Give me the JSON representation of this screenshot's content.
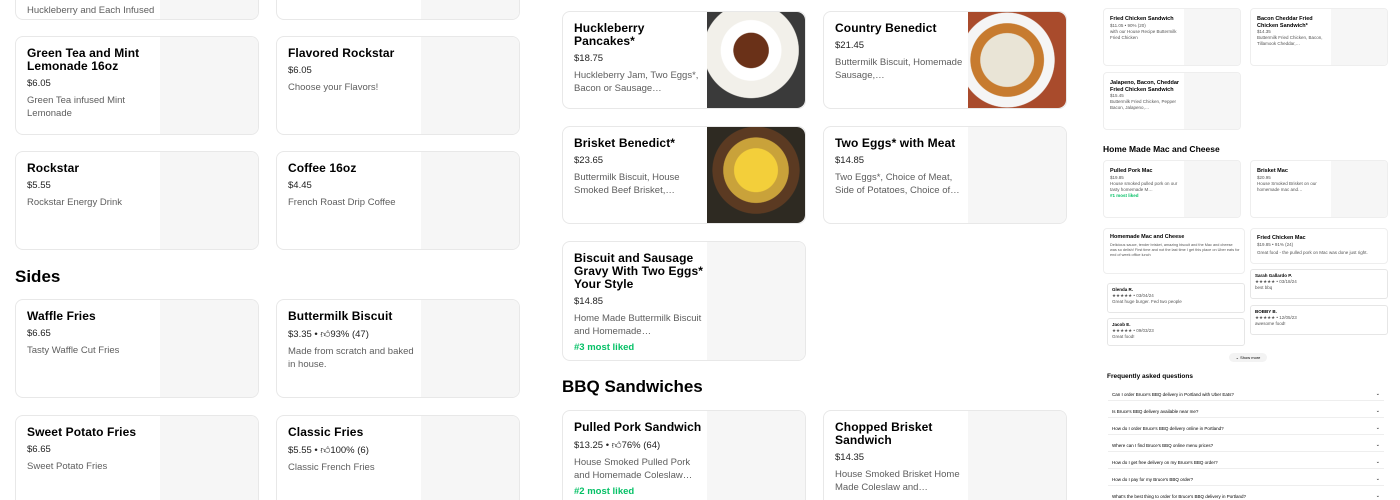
{
  "col1": {
    "top_card_text": "Huckleberry and Each Infused",
    "items": [
      {
        "name": "Green Tea and Mint Lemonade 16oz",
        "price": "$6.05",
        "desc": "Green Tea infused Mint Lemonade"
      },
      {
        "name": "Rockstar",
        "price": "$5.55",
        "desc": "Rockstar Energy Drink"
      }
    ]
  },
  "col2": {
    "items": [
      {
        "name": "Flavored Rockstar",
        "price": "$6.05",
        "desc": "Choose your Flavors!"
      },
      {
        "name": "Coffee 16oz",
        "price": "$4.45",
        "desc": "French Roast Drip Coffee"
      }
    ]
  },
  "sides": {
    "title": "Sides",
    "items": [
      {
        "name": "Waffle Fries",
        "price": "$6.65",
        "desc": "Tasty Waffle Cut Fries"
      },
      {
        "name": "Buttermilk Biscuit",
        "price": "$3.35",
        "rating": "93% (47)",
        "desc": "Made from scratch and baked in house."
      },
      {
        "name": "Sweet Potato Fries",
        "price": "$6.65",
        "desc": "Sweet Potato Fries"
      },
      {
        "name": "Classic Fries",
        "price": "$5.55",
        "rating": "100% (6)",
        "desc": "Classic French Fries"
      }
    ]
  },
  "breakfast": {
    "items": [
      {
        "name": "Huckleberry Pancakes*",
        "price": "$18.75",
        "desc": "Huckleberry Jam, Two Eggs*, Bacon or Sausage…"
      },
      {
        "name": "Country Benedict",
        "price": "$21.45",
        "desc": "Buttermilk Biscuit, Homemade Sausage,…"
      },
      {
        "name": "Brisket Benedict*",
        "price": "$23.65",
        "desc": "Buttermilk Biscuit, House Smoked Beef Brisket,…"
      },
      {
        "name": "Two Eggs* with Meat",
        "price": "$14.85",
        "desc": "Two Eggs*, Choice of Meat, Side of Potatoes, Choice of…"
      },
      {
        "name": "Biscuit and Sausage Gravy With Two Eggs* Your Style",
        "price": "$14.85",
        "desc": "Home Made Buttermilk Biscuit and Homemade…",
        "liked": "#3 most liked"
      }
    ]
  },
  "bbq": {
    "title": "BBQ Sandwiches",
    "items": [
      {
        "name": "Pulled Pork Sandwich",
        "price": "$13.25",
        "rating": "76% (64)",
        "desc": "House Smoked Pulled Pork and Homemade Coleslaw…",
        "liked": "#2 most liked"
      },
      {
        "name": "Chopped Brisket Sandwich",
        "price": "$14.35",
        "desc": "House Smoked Brisket Home Made Coleslaw and…"
      }
    ]
  },
  "mini": {
    "cards_top": [
      {
        "name": "Fried Chicken Sandwich",
        "sub": "$11.05 • 90% (20)",
        "desc": "with our House Recipe Buttermilk Fried Chicken"
      },
      {
        "name": "Bacon Cheddar Fried Chicken Sandwich*",
        "sub": "$14.35",
        "desc": "Buttermilk Fried Chicken, Bacon, Tillamook Cheddar,…"
      },
      {
        "name": "Jalapeno, Bacon, Cheddar Fried Chicken Sandwich",
        "sub": "$15.45",
        "desc": "Buttermilk Fried Chicken, Pepper Bacon, Jalapeno,…"
      }
    ],
    "mac_title": "Home Made Mac and Cheese",
    "mac_cards": [
      {
        "name": "Pulled Pork Mac",
        "sub": "$19.85",
        "desc": "House smoked pulled pork on our tasty homemade M…",
        "liked": "#1 most liked"
      },
      {
        "name": "Brisket Mac",
        "sub": "$20.95",
        "desc": "House Smoked Brisket on our homemade mac and…"
      }
    ],
    "homemade": {
      "name": "Homemade Mac and Cheese",
      "desc": "Delicious sauce, tender brisket, amazing biscuit and the Mac and cheese was so delish! First time and not the last time I get this place on Uber eats for end of week office lunch"
    },
    "fried_mac": {
      "name": "Fried Chicken Mac",
      "sub": "$19.85 • 91% (24)",
      "desc": "Great food - the pulled pork on Mac was done just right."
    },
    "reviews": [
      {
        "name": "Glenda R.",
        "stars": "★★★★★ • 03/04/24",
        "text": "Great huge burger. Fed two people"
      },
      {
        "name": "Sarah Gallardo P.",
        "stars": "★★★★★ • 03/18/24",
        "text": "best bbq"
      },
      {
        "name": "Jacob E.",
        "stars": "★★★★★ • 09/03/23",
        "text": "Great food!"
      },
      {
        "name": "BOBBY B.",
        "stars": "★★★★★ • 12/05/23",
        "text": "awesome food!"
      }
    ],
    "show_more": "Show more",
    "faq_title": "Frequently asked questions",
    "faqs": [
      "Can I order Bruce's BBQ delivery in Portland with Uber Eats?",
      "Is Bruce's BBQ delivery available near me?",
      "How do I order Bruce's BBQ delivery online in Portland?",
      "Where can I find Bruce's BBQ online menu prices?",
      "How do I get free delivery on my Bruce's BBQ order?",
      "How do I pay for my Bruce's BBQ order?",
      "What's the best thing to order for Bruce's BBQ delivery in Portland?"
    ]
  }
}
